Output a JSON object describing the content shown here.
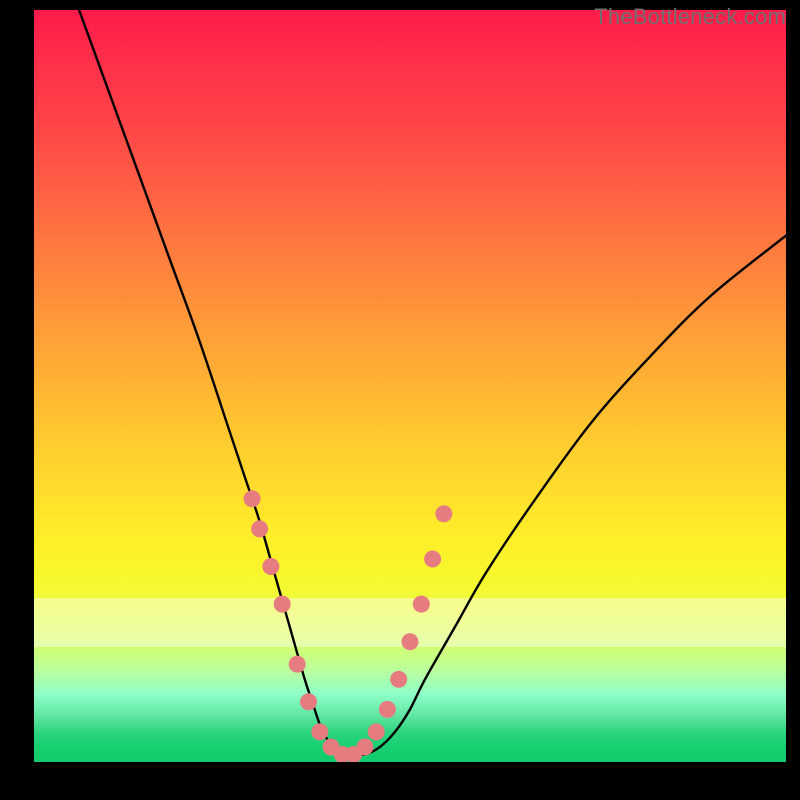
{
  "watermark": "TheBottleneck.com",
  "colors": {
    "background": "#000000",
    "curve": "#000000",
    "marker_fill": "#e67c80",
    "marker_stroke": "#cf5a5f",
    "gradient_top": "#ff1a4a",
    "gradient_bottom": "#12cb6c"
  },
  "chart_data": {
    "type": "line",
    "title": "",
    "xlabel": "",
    "ylabel": "",
    "xlim": [
      0,
      100
    ],
    "ylim": [
      0,
      100
    ],
    "grid": false,
    "legend_position": "none",
    "series": [
      {
        "name": "bottleneck-curve",
        "x": [
          6,
          10,
          14,
          18,
          22,
          26,
          28,
          30,
          32,
          34,
          36,
          37,
          38,
          39,
          40,
          41,
          42,
          44,
          46,
          48,
          50,
          52,
          56,
          60,
          66,
          74,
          82,
          90,
          100
        ],
        "y": [
          100,
          89,
          78,
          67,
          56,
          44,
          38,
          32,
          25,
          18,
          11,
          8,
          5,
          3,
          2,
          1,
          1,
          1,
          2,
          4,
          7,
          11,
          18,
          25,
          34,
          45,
          54,
          62,
          70
        ]
      }
    ],
    "markers": {
      "name": "sample-points",
      "x": [
        29,
        30,
        31.5,
        33,
        35,
        36.5,
        38,
        39.5,
        41,
        42.5,
        44,
        45.5,
        47,
        48.5,
        50,
        51.5,
        53,
        54.5
      ],
      "y": [
        35,
        31,
        26,
        21,
        13,
        8,
        4,
        2,
        1,
        1,
        2,
        4,
        7,
        11,
        16,
        21,
        27,
        33
      ]
    }
  }
}
